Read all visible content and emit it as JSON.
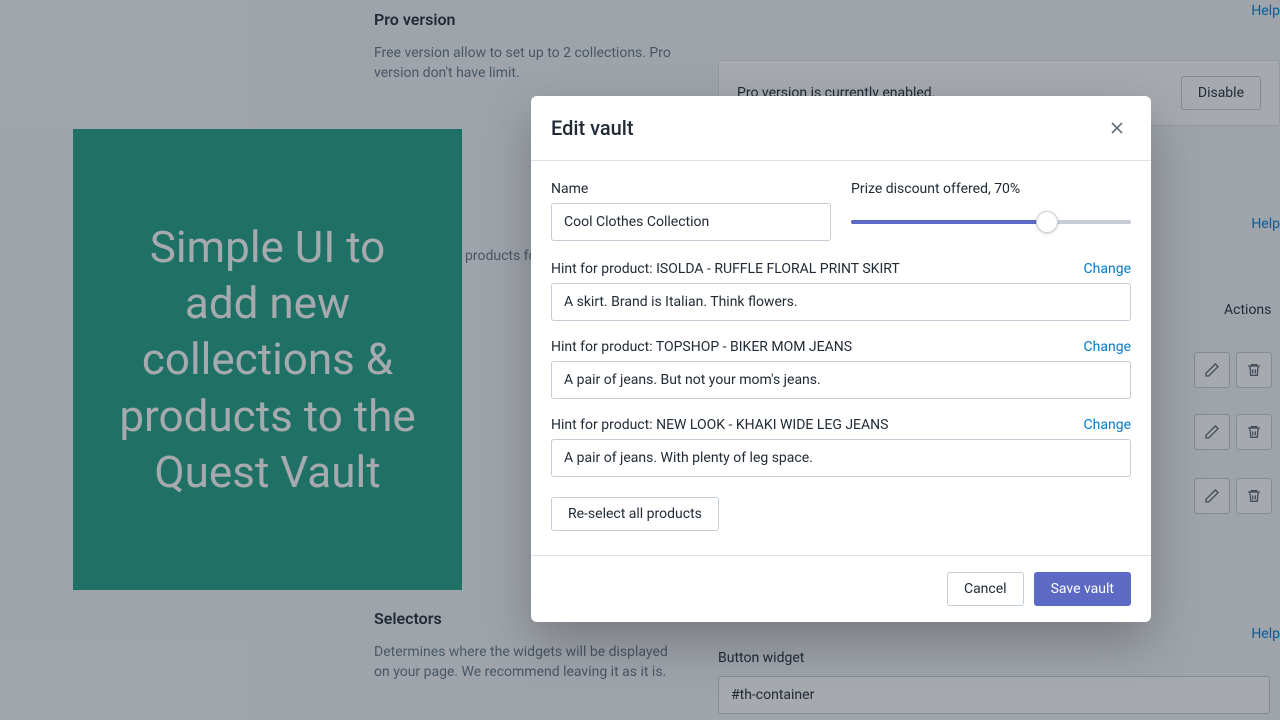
{
  "help_label": "Help",
  "pro_section": {
    "title": "Pro version",
    "desc": "Free version allow to set up to 2 collections. Pro version don't have limit."
  },
  "banner": {
    "status": "Pro version is currently enabled.",
    "disable_btn": "Disable"
  },
  "stray_text": "products fo",
  "callout": "Simple UI to add new collections & products to the Quest Vault",
  "actions_header": "Actions",
  "selectors_section": {
    "title": "Selectors",
    "desc": "Determines where the widgets will be displayed on your page. We recommend leaving it as it is."
  },
  "button_widget": {
    "label": "Button widget",
    "value": "#th-container"
  },
  "modal": {
    "title": "Edit vault",
    "name_label": "Name",
    "name_value": "Cool Clothes Collection",
    "slider_label": "Prize discount offered, 70%",
    "slider_percent": 70,
    "hints": [
      {
        "label": "Hint for product: ISOLDA - RUFFLE FLORAL PRINT SKIRT",
        "value": "A skirt. Brand is Italian. Think flowers."
      },
      {
        "label": "Hint for product: TOPSHOP - BIKER MOM JEANS",
        "value": "A pair of jeans. But not your mom's jeans."
      },
      {
        "label": "Hint for product: NEW LOOK - KHAKI WIDE LEG JEANS",
        "value": "A pair of jeans. With plenty of leg space."
      }
    ],
    "change_label": "Change",
    "reselect_label": "Re-select all products",
    "cancel_label": "Cancel",
    "save_label": "Save vault"
  }
}
